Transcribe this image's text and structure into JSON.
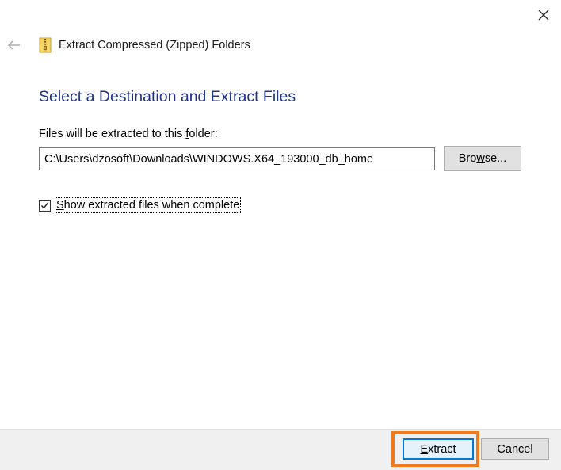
{
  "window": {
    "title": "Extract Compressed (Zipped) Folders",
    "close_icon": "close-icon",
    "back_icon": "back-arrow-icon",
    "app_icon": "zip-folder-icon"
  },
  "main": {
    "heading": "Select a Destination and Extract Files",
    "destination_label_prefix": "Files will be extracted to this ",
    "destination_label_accel": "f",
    "destination_label_suffix": "older:",
    "destination_path": "C:\\Users\\dzosoft\\Downloads\\WINDOWS.X64_193000_db_home",
    "browse_accel": "w",
    "browse_prefix": "Bro",
    "browse_suffix": "se...",
    "show_files_accel": "S",
    "show_files_suffix": "how extracted files when complete",
    "show_files_checked": true
  },
  "footer": {
    "extract_accel": "E",
    "extract_suffix": "xtract",
    "cancel_label": "Cancel"
  },
  "colors": {
    "heading": "#1e3287",
    "highlight": "#f07b1e",
    "default_button_border": "#0078d7"
  }
}
